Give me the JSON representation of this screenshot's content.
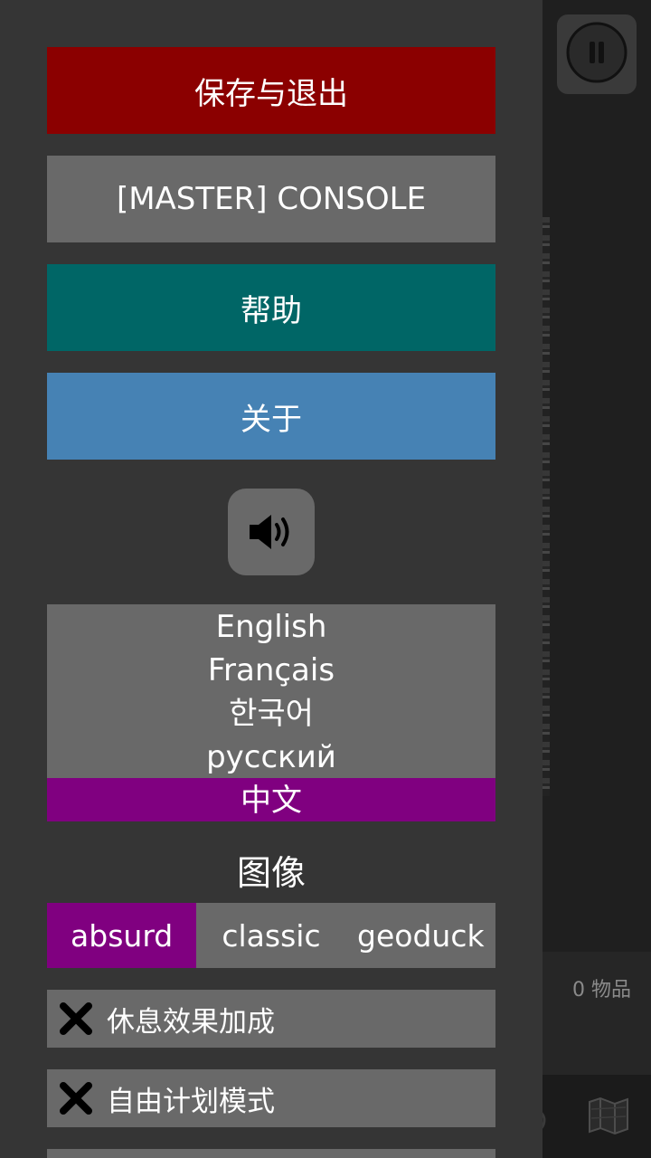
{
  "menu": {
    "save_exit_label": "保存与退出",
    "console_label": "[MASTER] CONSOLE",
    "help_label": "帮助",
    "about_label": "关于",
    "sound_icon": "speaker-volume-icon",
    "languages": [
      {
        "label": "English",
        "selected": false
      },
      {
        "label": "Français",
        "selected": false
      },
      {
        "label": "한국어",
        "selected": false
      },
      {
        "label": "русский",
        "selected": false
      },
      {
        "label": "中文",
        "selected": true
      }
    ],
    "graphics_title": "图像",
    "graphics_styles": [
      {
        "label": "absurd",
        "selected": true
      },
      {
        "label": "classic",
        "selected": false
      },
      {
        "label": "geoduck",
        "selected": false
      }
    ],
    "toggles": [
      {
        "label": "休息效果加成",
        "state": "off",
        "icon": "x-icon"
      },
      {
        "label": "自由计划模式",
        "state": "off",
        "icon": "x-icon"
      }
    ]
  },
  "background": {
    "items_count": "0 物品",
    "pause_icon": "pause-icon",
    "map_icon": "map-icon"
  },
  "colors": {
    "save_exit": "#8b0000",
    "console": "#696969",
    "help": "#006666",
    "about": "#4682b4",
    "selected": "#800080",
    "menu_bg": "#353535"
  }
}
